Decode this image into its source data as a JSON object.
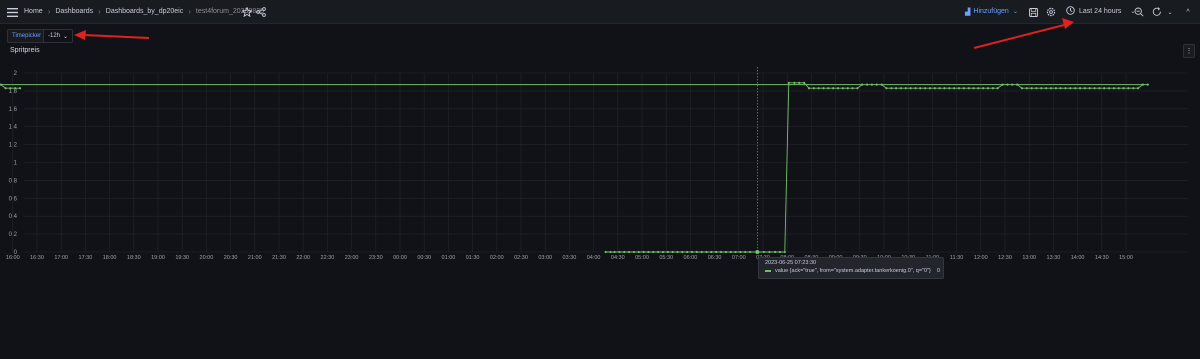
{
  "topbar": {
    "menu_icon": "hamburger-icon",
    "breadcrumbs": [
      "Home",
      "Dashboards",
      "Dashboards_by_dp20eic",
      "test4forum_20230825"
    ],
    "add_label": "Hinzufügen",
    "time_range_label": "Last 24 hours"
  },
  "variables": {
    "timepicker_label": "Timepicker",
    "timepicker_value": "-12h"
  },
  "panel": {
    "title": "Spritpreis",
    "menu_glyph": "⋮"
  },
  "tooltip": {
    "time": "2023-06-25 07:23:30",
    "series_label": "value {ack=\"true\", from=\"system.adapter.tankerkoenig.0\", q=\"0\"}",
    "value": "0"
  },
  "chart_data": {
    "type": "line",
    "x_ticks": [
      "16:30",
      "17:00",
      "17:30",
      "18:00",
      "18:30",
      "19:00",
      "19:30",
      "20:00",
      "20:30",
      "21:00",
      "21:30",
      "22:00",
      "22:30",
      "23:00",
      "23:30",
      "00:00",
      "00:30",
      "01:00",
      "01:30",
      "02:00",
      "02:30",
      "03:00",
      "03:30",
      "04:00",
      "04:30",
      "05:00",
      "05:30",
      "06:00",
      "06:30",
      "07:00",
      "07:30",
      "08:00",
      "08:30",
      "09:00",
      "09:30",
      "10:00",
      "10:30",
      "11:00",
      "11:30",
      "12:00",
      "12:30",
      "13:00",
      "13:30",
      "14:00",
      "14:30",
      "15:00",
      "15:30",
      "16:00"
    ],
    "y_ticks": [
      "0",
      "0.2",
      "0.4",
      "0.6",
      "0.8",
      "1",
      "1.2",
      "1.4",
      "1.6",
      "1.8",
      "2"
    ],
    "ylim": [
      0,
      2
    ],
    "grid": true,
    "series": [
      {
        "color": "#73bf69",
        "points": [
          [
            "04:15",
            0
          ],
          [
            "04:21",
            0
          ],
          [
            "04:26",
            0
          ],
          [
            "04:32",
            0
          ],
          [
            "04:38",
            0
          ],
          [
            "04:44",
            0
          ],
          [
            "04:50",
            0
          ],
          [
            "04:56",
            0
          ],
          [
            "05:02",
            0
          ],
          [
            "05:08",
            0
          ],
          [
            "05:14",
            0
          ],
          [
            "05:20",
            0
          ],
          [
            "05:26",
            0
          ],
          [
            "05:32",
            0
          ],
          [
            "05:38",
            0
          ],
          [
            "05:44",
            0
          ],
          [
            "05:50",
            0
          ],
          [
            "05:56",
            0
          ],
          [
            "06:02",
            0
          ],
          [
            "06:08",
            0
          ],
          [
            "06:14",
            0
          ],
          [
            "06:20",
            0
          ],
          [
            "06:26",
            0
          ],
          [
            "06:32",
            0
          ],
          [
            "06:38",
            0
          ],
          [
            "06:44",
            0
          ],
          [
            "06:50",
            0
          ],
          [
            "06:56",
            0
          ],
          [
            "07:02",
            0
          ],
          [
            "07:08",
            0
          ],
          [
            "07:14",
            0
          ],
          [
            "07:23",
            0
          ],
          [
            "07:31",
            0
          ],
          [
            "07:38",
            0
          ],
          [
            "07:45",
            0
          ],
          [
            "07:51",
            0
          ],
          [
            "07:57",
            0
          ],
          [
            "08:02",
            1.89
          ],
          [
            "08:09",
            1.89
          ],
          [
            "08:15",
            1.89
          ],
          [
            "08:21",
            1.89
          ],
          [
            "08:27",
            1.83
          ],
          [
            "08:33",
            1.83
          ],
          [
            "08:39",
            1.83
          ],
          [
            "08:45",
            1.83
          ],
          [
            "08:51",
            1.83
          ],
          [
            "08:57",
            1.83
          ],
          [
            "09:03",
            1.83
          ],
          [
            "09:09",
            1.83
          ],
          [
            "09:15",
            1.83
          ],
          [
            "09:21",
            1.83
          ],
          [
            "09:27",
            1.83
          ],
          [
            "09:33",
            1.87
          ],
          [
            "09:39",
            1.87
          ],
          [
            "09:45",
            1.87
          ],
          [
            "09:51",
            1.87
          ],
          [
            "09:57",
            1.87
          ],
          [
            "10:03",
            1.83
          ],
          [
            "10:09",
            1.83
          ],
          [
            "10:15",
            1.83
          ],
          [
            "10:21",
            1.83
          ],
          [
            "10:27",
            1.83
          ],
          [
            "10:33",
            1.83
          ],
          [
            "10:39",
            1.83
          ],
          [
            "10:45",
            1.83
          ],
          [
            "10:51",
            1.83
          ],
          [
            "10:57",
            1.83
          ],
          [
            "11:03",
            1.83
          ],
          [
            "11:09",
            1.83
          ],
          [
            "11:15",
            1.83
          ],
          [
            "11:21",
            1.83
          ],
          [
            "11:27",
            1.83
          ],
          [
            "11:33",
            1.83
          ],
          [
            "11:39",
            1.83
          ],
          [
            "11:45",
            1.83
          ],
          [
            "11:51",
            1.83
          ],
          [
            "11:57",
            1.83
          ],
          [
            "12:03",
            1.83
          ],
          [
            "12:09",
            1.83
          ],
          [
            "12:15",
            1.83
          ],
          [
            "12:21",
            1.83
          ],
          [
            "12:27",
            1.87
          ],
          [
            "12:33",
            1.87
          ],
          [
            "12:39",
            1.87
          ],
          [
            "12:45",
            1.87
          ],
          [
            "12:51",
            1.83
          ],
          [
            "12:57",
            1.83
          ],
          [
            "13:03",
            1.83
          ],
          [
            "13:09",
            1.83
          ],
          [
            "13:15",
            1.83
          ],
          [
            "13:21",
            1.83
          ],
          [
            "13:27",
            1.83
          ],
          [
            "13:33",
            1.83
          ],
          [
            "13:39",
            1.83
          ],
          [
            "13:45",
            1.83
          ],
          [
            "13:51",
            1.83
          ],
          [
            "13:57",
            1.83
          ],
          [
            "14:03",
            1.83
          ],
          [
            "14:09",
            1.83
          ],
          [
            "14:15",
            1.83
          ],
          [
            "14:21",
            1.83
          ],
          [
            "14:27",
            1.83
          ],
          [
            "14:33",
            1.83
          ],
          [
            "14:39",
            1.83
          ],
          [
            "14:45",
            1.83
          ],
          [
            "14:51",
            1.83
          ],
          [
            "14:57",
            1.83
          ],
          [
            "15:03",
            1.83
          ],
          [
            "15:09",
            1.83
          ],
          [
            "15:15",
            1.83
          ],
          [
            "15:21",
            1.87
          ],
          [
            "15:27",
            1.87
          ],
          [
            "15:33",
            1.87
          ],
          [
            "15:39",
            1.87
          ],
          [
            "15:45",
            1.87
          ],
          [
            "15:51",
            1.83
          ],
          [
            "15:57",
            1.83
          ],
          [
            "16:03",
            1.83
          ],
          [
            "16:09",
            1.83
          ]
        ]
      }
    ],
    "hover_x": "07:23"
  }
}
